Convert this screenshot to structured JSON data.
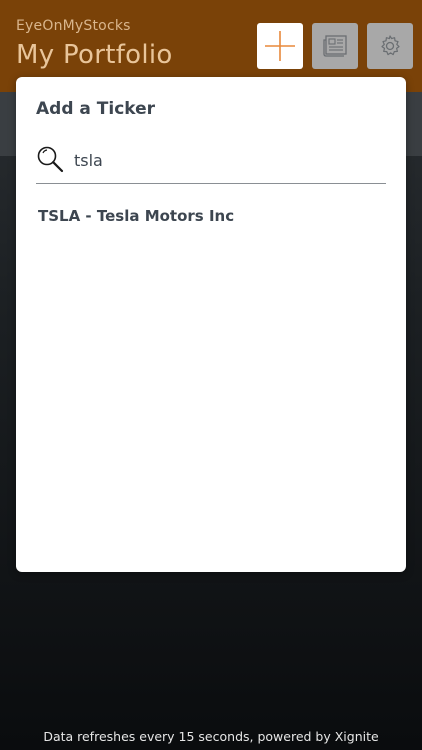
{
  "header": {
    "app_name": "EyeOnMyStocks",
    "title": "My Portfolio",
    "buttons": [
      {
        "icon": "plus-icon"
      },
      {
        "icon": "news-icon"
      },
      {
        "icon": "gear-icon"
      }
    ]
  },
  "modal": {
    "title": "Add a Ticker",
    "search": {
      "value": "tsla",
      "icon": "search-icon"
    },
    "results": [
      "TSLA - Tesla Motors Inc"
    ]
  },
  "footer": {
    "text": "Data refreshes every 15 seconds, powered by Xignite"
  },
  "colors": {
    "header_bg": "#7a4208",
    "accent": "#e8883a",
    "modal_bg": "#ffffff",
    "text_dark": "#3d4650"
  }
}
